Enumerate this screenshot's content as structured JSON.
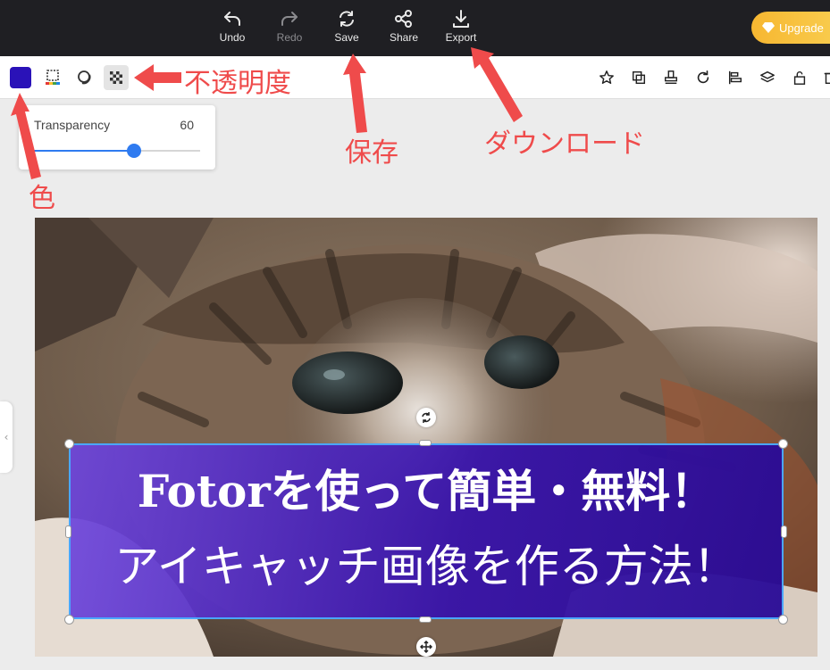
{
  "topbar": {
    "undo_label": "Undo",
    "redo_label": "Redo",
    "save_label": "Save",
    "share_label": "Share",
    "export_label": "Export",
    "upgrade_label": "Upgrade"
  },
  "toolbar": {
    "color_swatch": "#2a12b8",
    "left_tools": [
      "color-icon",
      "border-color-icon",
      "shadow-icon",
      "transparency-icon"
    ],
    "right_tools": [
      "star-icon",
      "duplicate-icon",
      "stamp-icon",
      "redo-rotate-icon",
      "align-icon",
      "layers-icon",
      "lock-icon",
      "trash-icon"
    ]
  },
  "transparency_panel": {
    "label": "Transparency",
    "value": "60",
    "fraction": 0.6
  },
  "canvas": {
    "line1": "Fotorを使って簡単・無料！",
    "line2": "アイキャッチ画像を作る方法！"
  },
  "annotations": {
    "opacity": "不透明度",
    "color": "色",
    "save": "保存",
    "download": "ダウンロード"
  },
  "colors": {
    "annotation_red": "#ef4b4b",
    "selection_blue": "#4aa6ff",
    "accent_blue": "#2f7bf0",
    "upgrade_gold": "#f7b731"
  }
}
